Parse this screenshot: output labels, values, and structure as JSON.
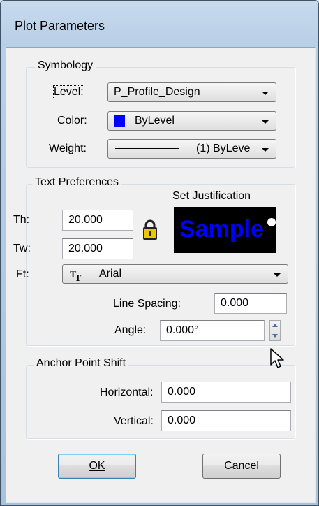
{
  "window": {
    "title": "Plot Parameters"
  },
  "symbology": {
    "legend": "Symbology",
    "level_label": "Level:",
    "level_value": "P_Profile_Design",
    "color_label": "Color:",
    "color_value": "ByLevel",
    "color_swatch": "#0000ff",
    "weight_label": "Weight:",
    "weight_value": "(1) ByLeve"
  },
  "text_prefs": {
    "legend": "Text Preferences",
    "justification_label": "Set Justification",
    "sample_text": "Sample",
    "sample_color": "#0000ff",
    "th_label": "Th:",
    "th_value": "20.000",
    "tw_label": "Tw:",
    "tw_value": "20.000",
    "ft_label": "Ft:",
    "font_value": "Arial",
    "line_spacing_label": "Line Spacing:",
    "line_spacing_value": "0.000",
    "angle_label": "Angle:",
    "angle_value": "0.000°"
  },
  "anchor": {
    "legend": "Anchor Point Shift",
    "horizontal_label": "Horizontal:",
    "horizontal_value": "0.000",
    "vertical_label": "Vertical:",
    "vertical_value": "0.000"
  },
  "buttons": {
    "ok": "OK",
    "cancel": "Cancel"
  }
}
